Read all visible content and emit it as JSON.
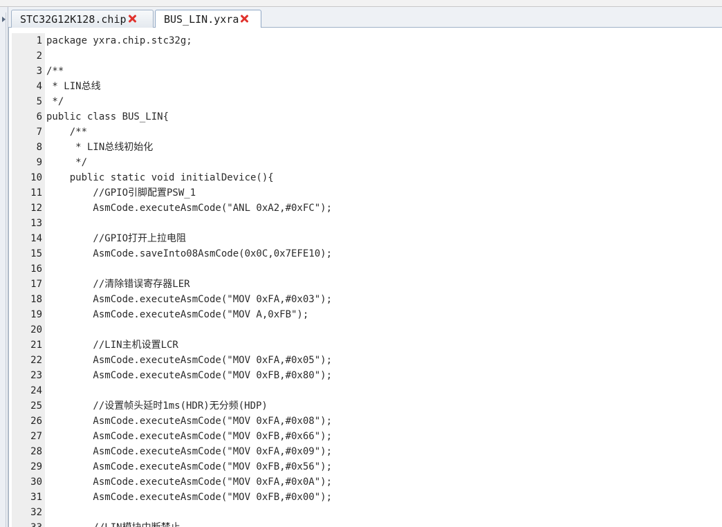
{
  "tabs": [
    {
      "label": "STC32G12K128.chip",
      "active": false
    },
    {
      "label": "BUS_LIN.yxra",
      "active": true
    }
  ],
  "editor": {
    "lines": [
      {
        "n": "1",
        "text": "package yxra.chip.stc32g;"
      },
      {
        "n": "2",
        "text": ""
      },
      {
        "n": "3",
        "text": "/**"
      },
      {
        "n": "4",
        "text": " * LIN总线"
      },
      {
        "n": "5",
        "text": " */"
      },
      {
        "n": "6",
        "text": "public class BUS_LIN{"
      },
      {
        "n": "7",
        "text": "    /**"
      },
      {
        "n": "8",
        "text": "     * LIN总线初始化"
      },
      {
        "n": "9",
        "text": "     */"
      },
      {
        "n": "10",
        "text": "    public static void initialDevice(){"
      },
      {
        "n": "11",
        "text": "        //GPIO引脚配置PSW_1"
      },
      {
        "n": "12",
        "text": "        AsmCode.executeAsmCode(\"ANL 0xA2,#0xFC\");"
      },
      {
        "n": "13",
        "text": ""
      },
      {
        "n": "14",
        "text": "        //GPIO打开上拉电阻"
      },
      {
        "n": "15",
        "text": "        AsmCode.saveInto08AsmCode(0x0C,0x7EFE10);"
      },
      {
        "n": "16",
        "text": ""
      },
      {
        "n": "17",
        "text": "        //清除错误寄存器LER"
      },
      {
        "n": "18",
        "text": "        AsmCode.executeAsmCode(\"MOV 0xFA,#0x03\");"
      },
      {
        "n": "19",
        "text": "        AsmCode.executeAsmCode(\"MOV A,0xFB\");"
      },
      {
        "n": "20",
        "text": ""
      },
      {
        "n": "21",
        "text": "        //LIN主机设置LCR"
      },
      {
        "n": "22",
        "text": "        AsmCode.executeAsmCode(\"MOV 0xFA,#0x05\");"
      },
      {
        "n": "23",
        "text": "        AsmCode.executeAsmCode(\"MOV 0xFB,#0x80\");"
      },
      {
        "n": "24",
        "text": ""
      },
      {
        "n": "25",
        "text": "        //设置帧头延时1ms(HDR)无分频(HDP)"
      },
      {
        "n": "26",
        "text": "        AsmCode.executeAsmCode(\"MOV 0xFA,#0x08\");"
      },
      {
        "n": "27",
        "text": "        AsmCode.executeAsmCode(\"MOV 0xFB,#0x66\");"
      },
      {
        "n": "28",
        "text": "        AsmCode.executeAsmCode(\"MOV 0xFA,#0x09\");"
      },
      {
        "n": "29",
        "text": "        AsmCode.executeAsmCode(\"MOV 0xFB,#0x56\");"
      },
      {
        "n": "30",
        "text": "        AsmCode.executeAsmCode(\"MOV 0xFA,#0x0A\");"
      },
      {
        "n": "31",
        "text": "        AsmCode.executeAsmCode(\"MOV 0xFB,#0x00\");"
      },
      {
        "n": "32",
        "text": ""
      },
      {
        "n": "33",
        "text": "        //LIN模块中断禁止"
      }
    ]
  }
}
